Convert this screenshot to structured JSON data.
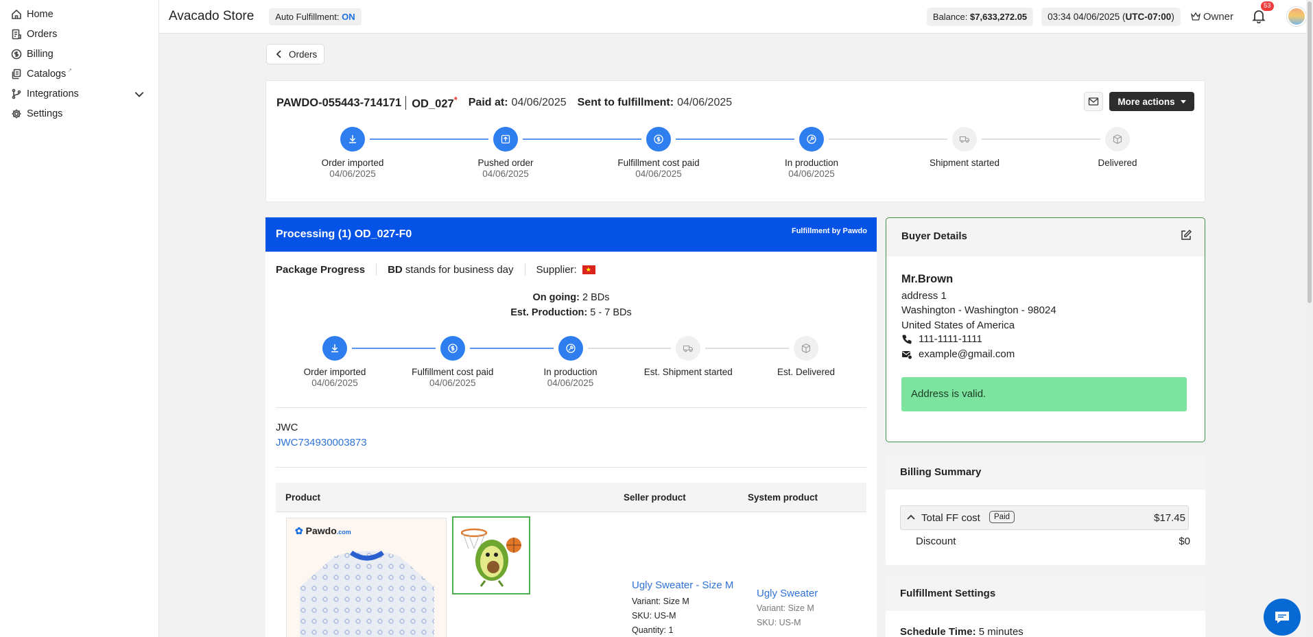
{
  "sidebar": {
    "items": [
      {
        "label": "Home",
        "icon": "home-icon"
      },
      {
        "label": "Orders",
        "icon": "orders-icon"
      },
      {
        "label": "Billing",
        "icon": "dollar-icon"
      },
      {
        "label": "Catalogs",
        "icon": "catalogs-icon"
      },
      {
        "label": "Integrations",
        "icon": "integrations-icon"
      },
      {
        "label": "Settings",
        "icon": "gear-icon"
      }
    ]
  },
  "topbar": {
    "store_name": "Avacado Store",
    "auto_fulfillment_label": "Auto Fulfillment:",
    "auto_fulfillment_value": "ON",
    "balance_label": "Balance:",
    "balance_value": "$7,633,272.05",
    "time": "03:34 04/06/2025",
    "timezone": "UTC-07:00",
    "owner_label": "Owner",
    "notification_count": "53"
  },
  "back_button": {
    "label": "Orders"
  },
  "order": {
    "id": "PAWDO-055443-714171",
    "code": "OD_027",
    "required_mark": "*",
    "paid_at_label": "Paid at:",
    "paid_at_value": "04/06/2025",
    "sent_label": "Sent to fulfillment:",
    "sent_value": "04/06/2025",
    "more_actions_label": "More actions",
    "steps": [
      {
        "label": "Order imported",
        "date": "04/06/2025",
        "done": true,
        "icon": "download-icon"
      },
      {
        "label": "Pushed order",
        "date": "04/06/2025",
        "done": true,
        "icon": "push-icon"
      },
      {
        "label": "Fulfillment cost paid",
        "date": "04/06/2025",
        "done": true,
        "icon": "dollar-icon"
      },
      {
        "label": "In production",
        "date": "04/06/2025",
        "done": true,
        "icon": "production-icon"
      },
      {
        "label": "Shipment started",
        "date": "",
        "done": false,
        "icon": "truck-icon"
      },
      {
        "label": "Delivered",
        "date": "",
        "done": false,
        "icon": "box-icon"
      }
    ]
  },
  "processing": {
    "title": "Processing (1) OD_027-F0",
    "fulfillment_by": "Fulfillment by Pawdo",
    "package_progress_label": "Package Progress",
    "bd_abbr": "BD",
    "bd_text": "stands for business day",
    "supplier_label": "Supplier:",
    "on_going_label": "On going:",
    "on_going_value": "2 BDs",
    "est_production_label": "Est. Production:",
    "est_production_value": "5 - 7 BDs",
    "steps": [
      {
        "label": "Order imported",
        "date": "04/06/2025",
        "done": true,
        "icon": "download-icon"
      },
      {
        "label": "Fulfillment cost paid",
        "date": "04/06/2025",
        "done": true,
        "icon": "dollar-icon"
      },
      {
        "label": "In production",
        "date": "04/06/2025",
        "done": true,
        "icon": "production-icon"
      },
      {
        "label": "Est. Shipment started",
        "date": "",
        "done": false,
        "icon": "truck-icon"
      },
      {
        "label": "Est. Delivered",
        "date": "",
        "done": false,
        "icon": "box-icon"
      }
    ],
    "carrier": "JWC",
    "tracking_number": "JWC734930003873",
    "table": {
      "headers": [
        "Product",
        "Seller product",
        "System product"
      ],
      "mockup_brand": "Pawdo",
      "mockup_brand_suffix": ".com",
      "seller_product": {
        "name": "Ugly Sweater - Size M",
        "variant": "Variant: Size M",
        "sku": "SKU: US-M",
        "quantity": "Quantity: 1"
      },
      "system_product": {
        "name": "Ugly Sweater",
        "variant": "Variant: Size M",
        "sku": "SKU: US-M"
      }
    }
  },
  "buyer": {
    "title": "Buyer Details",
    "name": "Mr.Brown",
    "address1": "address 1",
    "city_line": "Washington - Washington - 98024",
    "country": "United States of America",
    "phone": "111-1111-1111",
    "email": "example@gmail.com",
    "address_status": "Address is valid."
  },
  "billing_summary": {
    "title": "Billing Summary",
    "total_label": "Total FF cost",
    "paid_badge": "Paid",
    "total_value": "$17.45",
    "discount_label": "Discount",
    "discount_value": "$0"
  },
  "fulfillment_settings": {
    "title": "Fulfillment Settings",
    "schedule_label": "Schedule Time:",
    "schedule_value": "5 minutes"
  },
  "colors": {
    "accent": "#2f7ef0",
    "header_blue": "#0552e6",
    "valid_green": "#7de4a0"
  }
}
